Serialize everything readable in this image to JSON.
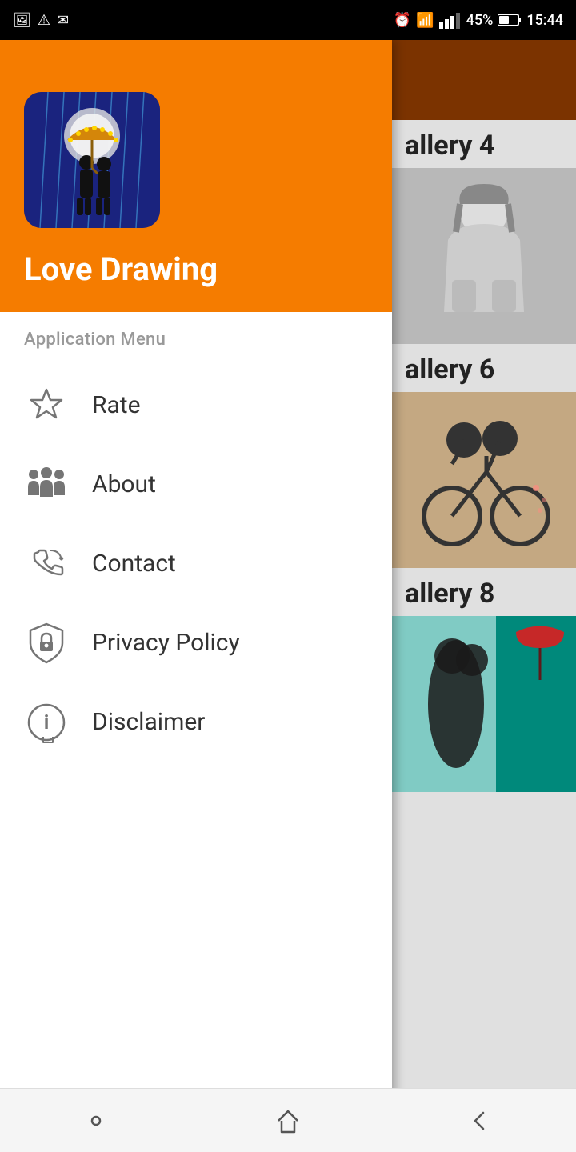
{
  "statusBar": {
    "leftIcons": [
      "image-icon",
      "warning-icon",
      "email-icon"
    ],
    "battery": "45%",
    "time": "15:44",
    "signalBars": "signal-icon",
    "batteryIcon": "battery-icon",
    "alarmIcon": "alarm-icon",
    "simIcon": "sim-icon"
  },
  "drawer": {
    "appTitle": "Love Drawing",
    "sectionLabel": "Application Menu",
    "menuItems": [
      {
        "id": "rate",
        "label": "Rate",
        "icon": "star-icon"
      },
      {
        "id": "about",
        "label": "About",
        "icon": "people-icon"
      },
      {
        "id": "contact",
        "label": "Contact",
        "icon": "phone-icon"
      },
      {
        "id": "privacy",
        "label": "Privacy Policy",
        "icon": "shield-icon"
      },
      {
        "id": "disclaimer",
        "label": "Disclaimer",
        "icon": "info-icon"
      }
    ]
  },
  "content": {
    "galleries": [
      {
        "label": "allery 4"
      },
      {
        "label": "allery 6"
      },
      {
        "label": "allery 8"
      }
    ]
  },
  "bottomNav": {
    "recentLabel": "recent-apps-icon",
    "homeLabel": "home-icon",
    "backLabel": "back-icon"
  }
}
